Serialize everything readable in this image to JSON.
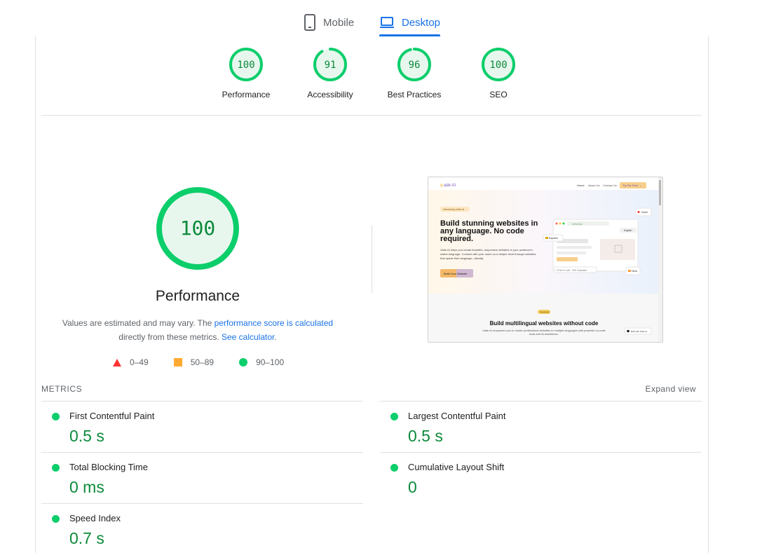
{
  "tabs": [
    {
      "label": "Mobile",
      "icon": "phone-icon"
    },
    {
      "label": "Desktop",
      "icon": "laptop-icon",
      "active": true
    }
  ],
  "gauges": [
    {
      "score": "100",
      "label": "Performance"
    },
    {
      "score": "91",
      "label": "Accessibility"
    },
    {
      "score": "96",
      "label": "Best Practices"
    },
    {
      "score": "100",
      "label": "SEO"
    }
  ],
  "performance": {
    "score": "100",
    "title": "Performance",
    "note_start": "Values are estimated and may vary. The ",
    "note_link1": "performance score is calculated",
    "note_mid": "directly from these metrics. ",
    "note_link2": "See calculator",
    "note_end": "."
  },
  "legend": [
    {
      "range": "0–49",
      "color": "#ff3333"
    },
    {
      "range": "50–89",
      "color": "#ffaa33"
    },
    {
      "range": "90–100",
      "color": "#0cce6b"
    }
  ],
  "screenshot": {
    "logo": "ade AI",
    "nav": [
      "Home",
      "About Us",
      "Contact Us"
    ],
    "cta": "Try For Free →",
    "badge": "Introducing Vade AI",
    "headline": "Build stunning websites in any language. No code required.",
    "body": "Vade AI helps you create beautiful, responsive websites in your audience's native language. Connect with your users on a deeper level through websites that speak their language—literally.",
    "button": "Build Your Website",
    "lang_en": "English",
    "lang_es": "Español",
    "lang_de": "Dutch",
    "lang_in": "Hindi",
    "chip": "0 lines of code · 100+ languages",
    "url": "vadeai.app",
    "section_badge": "Features",
    "section_title": "Build multilingual websites without code",
    "section_body": "Vade AI empowers you to create professional websites in multiple languages with powerful no-code tools and AI assistance.",
    "made": "Built with Vade AI"
  },
  "metrics": {
    "heading": "METRICS",
    "expand": "Expand view",
    "items": [
      {
        "name": "First Contentful Paint",
        "value": "0.5 s"
      },
      {
        "name": "Largest Contentful Paint",
        "value": "0.5 s"
      },
      {
        "name": "Total Blocking Time",
        "value": "0 ms"
      },
      {
        "name": "Cumulative Layout Shift",
        "value": "0"
      },
      {
        "name": "Speed Index",
        "value": "0.7 s"
      }
    ]
  },
  "colors": {
    "pass": "#0cce6b",
    "pass_text": "#0b8a3a",
    "accent": "#1a73e8"
  }
}
